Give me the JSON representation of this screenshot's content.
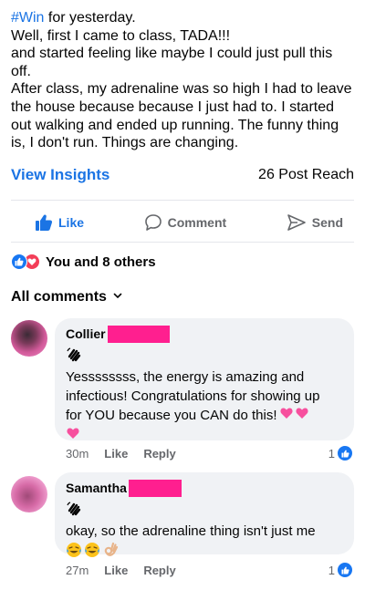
{
  "post": {
    "hashtag": "#Win",
    "line1_rest": " for yesterday.",
    "lines": [
      "Well, first I came to class, TADA!!!",
      "and started feeling like maybe I could just pull this",
      "off.",
      "After class, my adrenaline was so high I had to leave",
      "the house because because I just had to. I started",
      "out walking and ended up running. The funny thing",
      "is, I don't run. Things are changing."
    ]
  },
  "insights": {
    "view_label": "View Insights",
    "reach_label": "26 Post Reach"
  },
  "actions": {
    "like": "Like",
    "comment": "Comment",
    "send": "Send"
  },
  "reactions": {
    "summary": "You and 8 others"
  },
  "comments_header": {
    "label": "All comments"
  },
  "comments": [
    {
      "name": "Collier",
      "lines": [
        "Yessssssss, the energy is amazing and",
        "infectious! Congratulations for showing up",
        "for YOU because you CAN do this!"
      ],
      "time": "30m",
      "like_label": "Like",
      "reply_label": "Reply",
      "like_count": "1"
    },
    {
      "name": "Samantha",
      "lines": [
        "okay, so the adrenaline thing isn't just me"
      ],
      "time": "27m",
      "like_label": "Like",
      "reply_label": "Reply",
      "like_count": "1"
    }
  ],
  "colors": {
    "accent": "#1b74e4",
    "redaction": "#ff1f8f",
    "bubble": "#f0f2f5"
  },
  "icons": [
    "like-thumb-icon",
    "comment-bubble-icon",
    "send-icon",
    "love-reaction-icon",
    "wave-hand-icon",
    "two-hearts-icon",
    "laugh-cry-icon",
    "ok-hand-icon"
  ]
}
